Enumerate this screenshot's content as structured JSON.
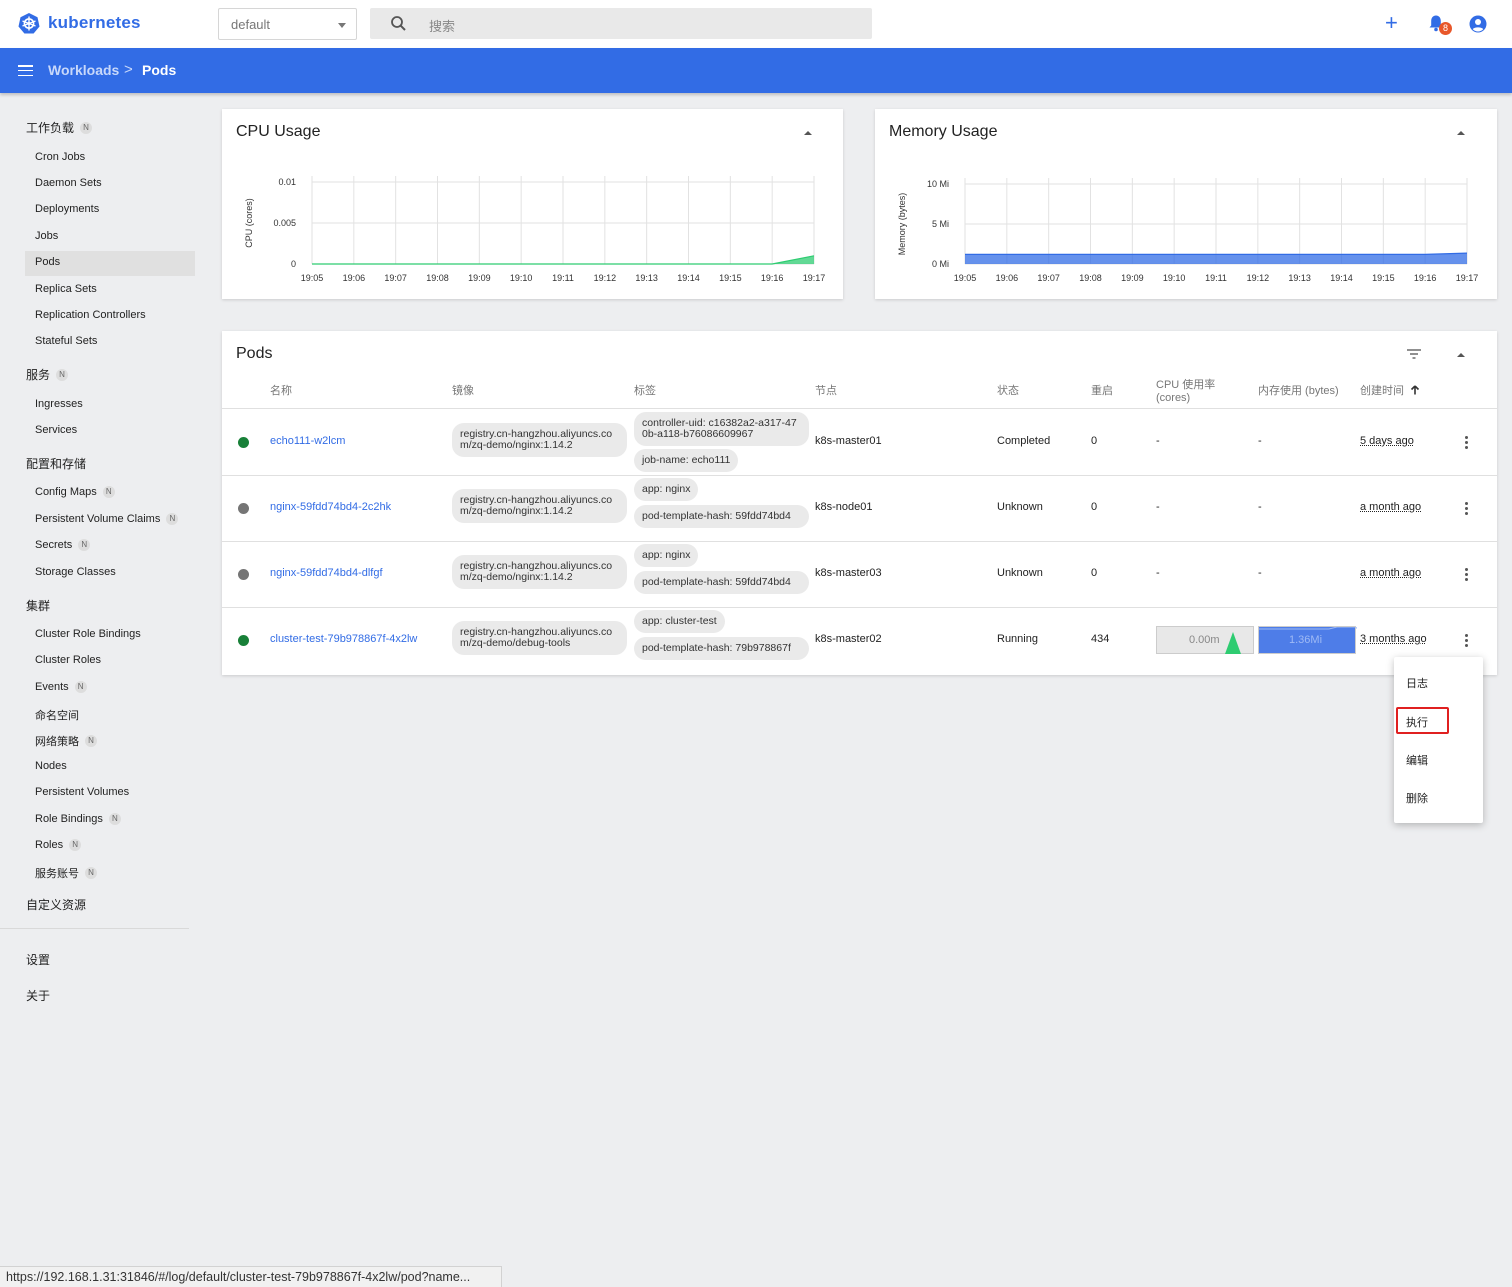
{
  "app": {
    "name": "kubernetes",
    "brand_color": "#326ce5"
  },
  "topbar": {
    "namespace": "default",
    "search_placeholder": "搜索",
    "create_icon": "plus-icon",
    "notifications_count": "8",
    "notifications_icon": "bell-icon",
    "account_icon": "account-circle-icon"
  },
  "breadcrumb": {
    "parent": "Workloads",
    "separator": ">",
    "current": "Pods"
  },
  "sidebar": {
    "sections": [
      {
        "label": "工作负载",
        "badge": "N"
      },
      {
        "label": "服务",
        "badge": "N"
      },
      {
        "label": "配置和存储"
      },
      {
        "label": "集群"
      },
      {
        "label": "自定义资源"
      }
    ],
    "workloads": [
      "Cron Jobs",
      "Daemon Sets",
      "Deployments",
      "Jobs",
      "Pods",
      "Replica Sets",
      "Replication Controllers",
      "Stateful Sets"
    ],
    "services": [
      "Ingresses",
      "Services"
    ],
    "config": [
      {
        "label": "Config Maps",
        "badge": "N"
      },
      {
        "label": "Persistent Volume Claims",
        "badge": "N"
      },
      {
        "label": "Secrets",
        "badge": "N"
      },
      {
        "label": "Storage Classes"
      }
    ],
    "cluster": [
      {
        "label": "Cluster Role Bindings"
      },
      {
        "label": "Cluster Roles"
      },
      {
        "label": "Events",
        "badge": "N"
      },
      {
        "label": "命名空间"
      },
      {
        "label": "网络策略",
        "badge": "N"
      },
      {
        "label": "Nodes"
      },
      {
        "label": "Persistent Volumes"
      },
      {
        "label": "Role Bindings",
        "badge": "N"
      },
      {
        "label": "Roles",
        "badge": "N"
      },
      {
        "label": "服务账号",
        "badge": "N"
      }
    ],
    "footer": [
      "设置",
      "关于"
    ],
    "active": "Pods"
  },
  "cpu_card": {
    "title": "CPU Usage"
  },
  "memory_card": {
    "title": "Memory Usage"
  },
  "chart_data": [
    {
      "type": "area",
      "title": "CPU Usage",
      "ylabel": "CPU (cores)",
      "x": [
        "19:05",
        "19:06",
        "19:07",
        "19:08",
        "19:09",
        "19:10",
        "19:11",
        "19:12",
        "19:13",
        "19:14",
        "19:15",
        "19:16",
        "19:17"
      ],
      "yticks": [
        "0",
        "0.005",
        "0.01"
      ],
      "ylim": [
        0,
        0.01
      ],
      "series": [
        {
          "values": [
            0,
            0,
            0,
            0,
            0,
            0,
            0,
            0,
            0,
            0,
            0,
            0,
            0.001
          ]
        }
      ],
      "color": "#2ecc71",
      "grid": true
    },
    {
      "type": "area",
      "title": "Memory Usage",
      "ylabel": "Memory (bytes)",
      "x": [
        "19:05",
        "19:06",
        "19:07",
        "19:08",
        "19:09",
        "19:10",
        "19:11",
        "19:12",
        "19:13",
        "19:14",
        "19:15",
        "19:16",
        "19:17"
      ],
      "yticks": [
        "0 Mi",
        "5 Mi",
        "10 Mi"
      ],
      "ylim": [
        0,
        10
      ],
      "series": [
        {
          "values": [
            1.2,
            1.2,
            1.2,
            1.2,
            1.2,
            1.2,
            1.2,
            1.2,
            1.2,
            1.2,
            1.2,
            1.2,
            1.36
          ]
        }
      ],
      "color": "#326ce5",
      "grid": true
    }
  ],
  "pods": {
    "title": "Pods",
    "columns": [
      "名称",
      "镜像",
      "标签",
      "节点",
      "状态",
      "重启",
      "CPU 使用率 (cores)",
      "内存使用 (bytes)",
      "创建时间"
    ],
    "sort_indicator": "arrow-up-icon",
    "rows": [
      {
        "status_color": "#188038",
        "name": "echo111-w2lcm",
        "image": "registry.cn-hangzhou.aliyuncs.com/zq-demo/nginx:1.14.2",
        "labels": [
          "controller-uid: c16382a2-a317-470b-a118-b76086609967",
          "job-name: echo111"
        ],
        "node": "k8s-master01",
        "status": "Completed",
        "restarts": "0",
        "cpu": "-",
        "memory": "-",
        "age": "5 days ago"
      },
      {
        "status_color": "#757575",
        "name": "nginx-59fdd74bd4-2c2hk",
        "image": "registry.cn-hangzhou.aliyuncs.com/zq-demo/nginx:1.14.2",
        "labels": [
          "app: nginx",
          "pod-template-hash: 59fdd74bd4"
        ],
        "node": "k8s-node01",
        "status": "Unknown",
        "restarts": "0",
        "cpu": "-",
        "memory": "-",
        "age": "a month ago"
      },
      {
        "status_color": "#757575",
        "name": "nginx-59fdd74bd4-dlfgf",
        "image": "registry.cn-hangzhou.aliyuncs.com/zq-demo/nginx:1.14.2",
        "labels": [
          "app: nginx",
          "pod-template-hash: 59fdd74bd4"
        ],
        "node": "k8s-master03",
        "status": "Unknown",
        "restarts": "0",
        "cpu": "-",
        "memory": "-",
        "age": "a month ago"
      },
      {
        "status_color": "#188038",
        "name": "cluster-test-79b978867f-4x2lw",
        "image": "registry.cn-hangzhou.aliyuncs.com/zq-demo/debug-tools",
        "labels": [
          "app: cluster-test",
          "pod-template-hash: 79b978867f"
        ],
        "node": "k8s-master02",
        "status": "Running",
        "restarts": "434",
        "cpu": "0.00m",
        "memory": "1.36Mi",
        "age": "3 months ago"
      }
    ]
  },
  "context_menu": {
    "items": [
      "日志",
      "执行",
      "编辑",
      "删除"
    ],
    "highlighted": "执行",
    "highlight_color": "#e02020"
  },
  "status_url": "https://192.168.1.31:31846/#/log/default/cluster-test-79b978867f-4x2lw/pod?name..."
}
